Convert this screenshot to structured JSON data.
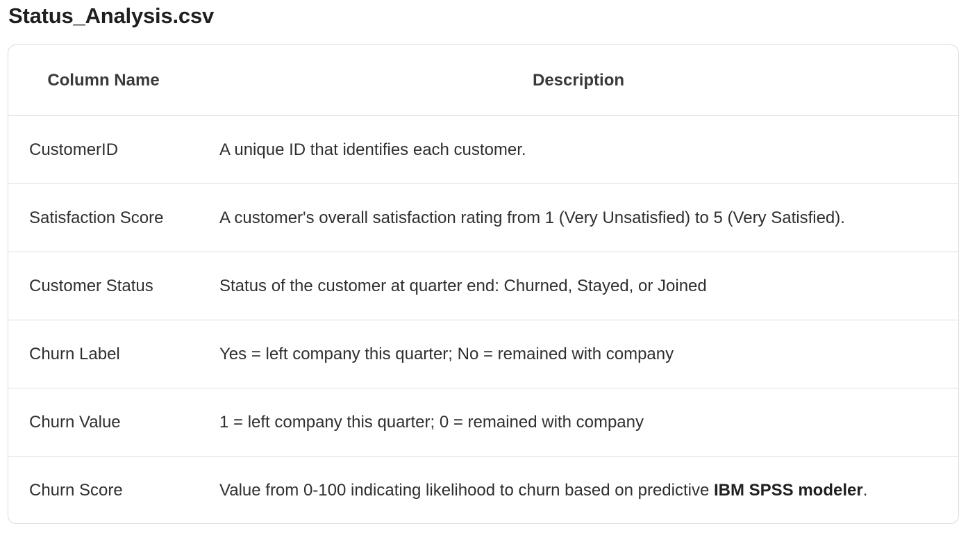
{
  "title": "Status_Analysis.csv",
  "table": {
    "headers": {
      "column_name": "Column Name",
      "description": "Description"
    },
    "rows": [
      {
        "name": "CustomerID",
        "description": "A unique ID that identifies each customer."
      },
      {
        "name": "Satisfaction Score",
        "description": "A customer's overall satisfaction rating from 1 (Very Unsatisfied) to 5 (Very Satisfied)."
      },
      {
        "name": "Customer Status",
        "description": "Status of the customer at quarter end: Churned, Stayed, or Joined"
      },
      {
        "name": "Churn Label",
        "description": "Yes = left company this quarter; No = remained with company"
      },
      {
        "name": "Churn Value",
        "description": "1 = left company this quarter; 0 = remained with company"
      },
      {
        "name": "Churn Score",
        "description_prefix": "Value from 0-100 indicating likelihood to churn based on predictive ",
        "description_bold": "IBM SPSS modeler",
        "description_suffix": "."
      }
    ]
  }
}
